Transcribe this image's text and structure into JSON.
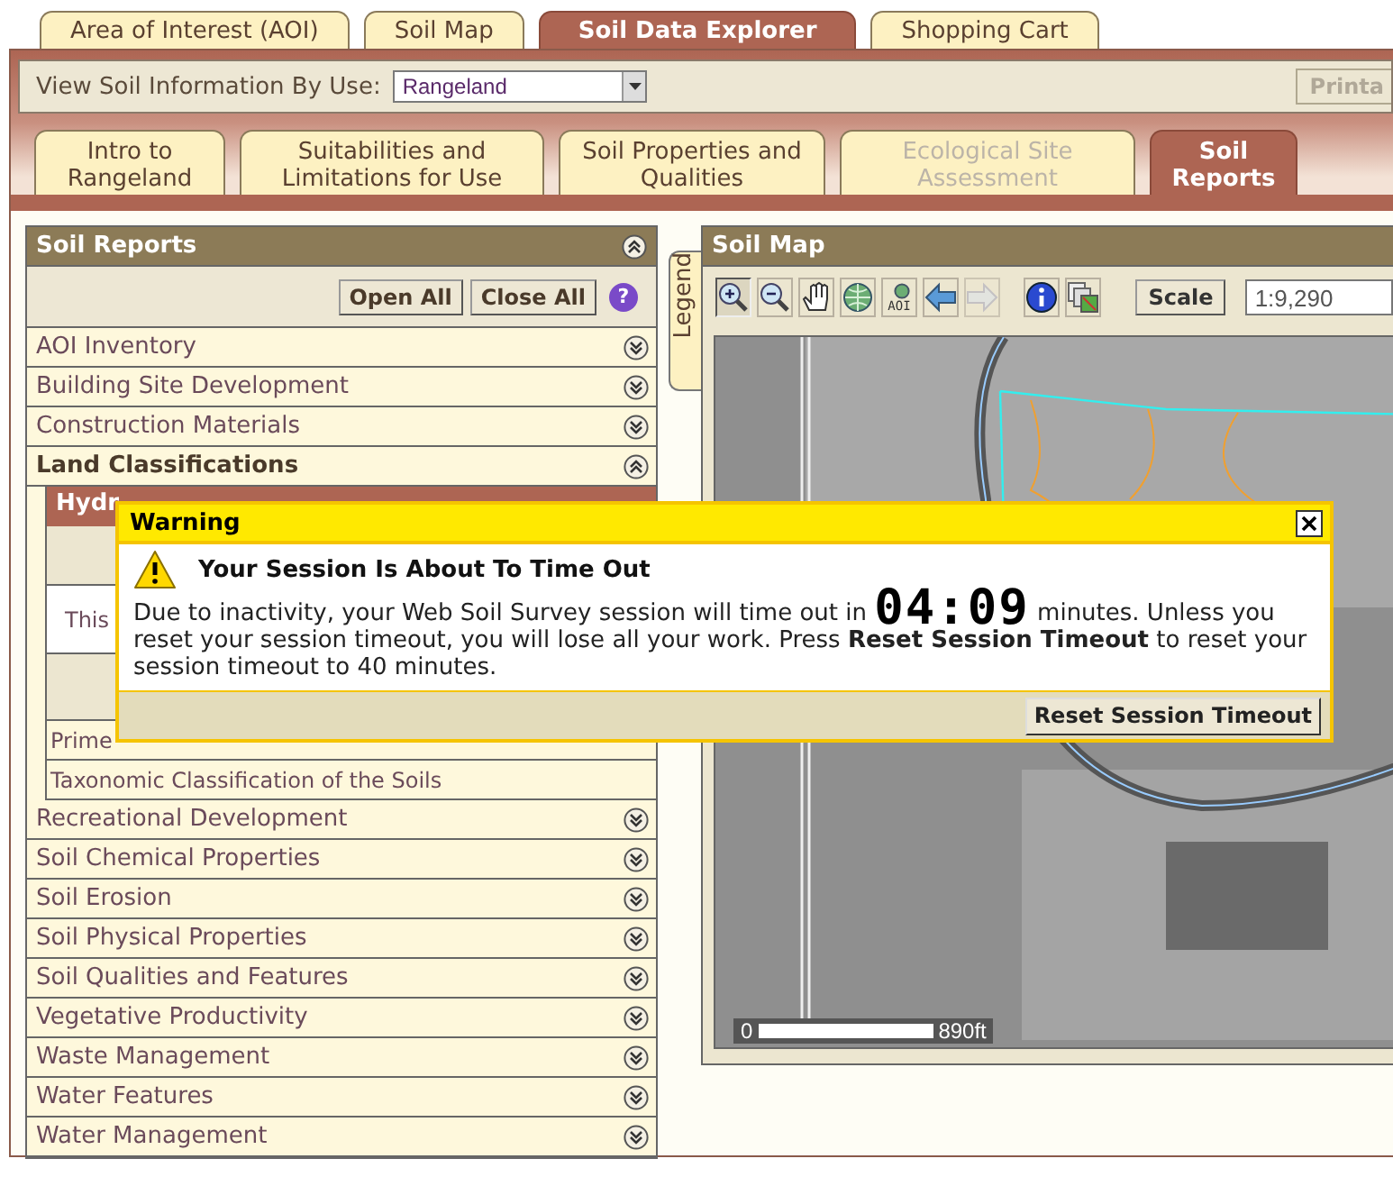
{
  "main_tabs": [
    {
      "label": "Area of Interest (AOI)",
      "selected": false
    },
    {
      "label": "Soil Map",
      "selected": false
    },
    {
      "label": "Soil Data Explorer",
      "selected": true
    },
    {
      "label": "Shopping Cart",
      "selected": false
    }
  ],
  "view_by_use": {
    "label": "View Soil Information By Use:",
    "value": "Rangeland",
    "print_button": "Printa"
  },
  "sub_tabs": [
    {
      "label": "Intro to Rangeland",
      "selected": false,
      "disabled": false
    },
    {
      "label": "Suitabilities and Limitations for Use",
      "selected": false,
      "disabled": false
    },
    {
      "label": "Soil Properties and Qualities",
      "selected": false,
      "disabled": false
    },
    {
      "label": "Ecological Site Assessment",
      "selected": false,
      "disabled": true
    },
    {
      "label": "Soil Reports",
      "selected": true,
      "disabled": false
    }
  ],
  "soil_reports": {
    "title": "Soil Reports",
    "buttons": [
      "Open All",
      "Close All"
    ],
    "help": "?",
    "items": [
      {
        "label": "AOI Inventory",
        "expanded": false
      },
      {
        "label": "Building Site Development",
        "expanded": false
      },
      {
        "label": "Construction Materials",
        "expanded": false
      },
      {
        "label": "Land Classifications",
        "expanded": true,
        "children": [
          {
            "kind": "section",
            "label": "Hydr"
          },
          {
            "kind": "text",
            "label": "This"
          },
          {
            "kind": "link",
            "label": "Prime"
          },
          {
            "kind": "link",
            "label": "Taxonomic Classification of the Soils"
          }
        ]
      },
      {
        "label": "Recreational Development",
        "expanded": false
      },
      {
        "label": "Soil Chemical Properties",
        "expanded": false
      },
      {
        "label": "Soil Erosion",
        "expanded": false
      },
      {
        "label": "Soil Physical Properties",
        "expanded": false
      },
      {
        "label": "Soil Qualities and Features",
        "expanded": false
      },
      {
        "label": "Vegetative Productivity",
        "expanded": false
      },
      {
        "label": "Waste Management",
        "expanded": false
      },
      {
        "label": "Water Features",
        "expanded": false
      },
      {
        "label": "Water Management",
        "expanded": false
      }
    ]
  },
  "legend_tab": "Legend",
  "soil_map": {
    "title": "Soil Map",
    "tools": [
      {
        "kind": "zoom-in",
        "selected": true,
        "disabled": false
      },
      {
        "kind": "zoom-out",
        "selected": false,
        "disabled": false
      },
      {
        "kind": "pan",
        "selected": false,
        "disabled": false
      },
      {
        "kind": "globe",
        "selected": false,
        "disabled": false
      },
      {
        "kind": "aoi",
        "label": "AOI",
        "selected": false,
        "disabled": false
      },
      {
        "kind": "back",
        "selected": false,
        "disabled": false
      },
      {
        "kind": "forward",
        "selected": false,
        "disabled": true
      },
      {
        "kind": "info",
        "selected": false,
        "disabled": false
      },
      {
        "kind": "layers",
        "selected": false,
        "disabled": false
      }
    ],
    "scale_button": "Scale",
    "scale_value": "1:9,290",
    "scale_bar": {
      "start": "0",
      "end": "890ft"
    }
  },
  "dialog": {
    "title": "Warning",
    "heading": "Your Session Is About To Time Out",
    "message_start": "Due to inactivity, your Web Soil Survey session will time out in",
    "countdown": "04:09",
    "message_end": "minutes. Unless you reset your session timeout, you will lose all your work. Press **Reset Session Timeout** to reset your session timeout to 40 minutes.",
    "button": "Reset Session Timeout"
  }
}
